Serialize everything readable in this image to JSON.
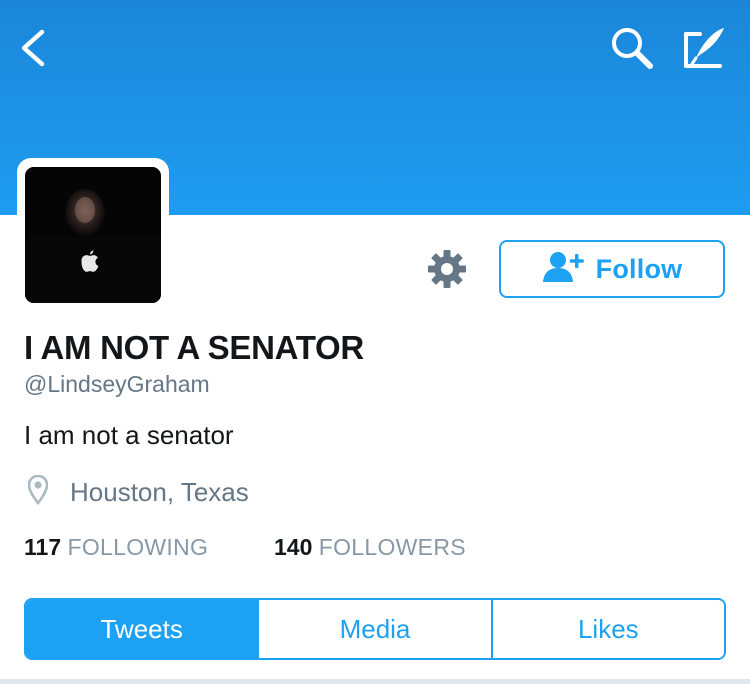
{
  "theme": {
    "accent": "#1da1f2",
    "header_blue": "#1d93e6",
    "muted": "#657786",
    "text": "#14171a"
  },
  "header": {
    "back_icon": "chevron-left-icon",
    "search_icon": "search-icon",
    "compose_icon": "compose-tweet-icon"
  },
  "profile": {
    "avatar_icon": "apple-logo-icon",
    "display_name": "I AM NOT A SENATOR",
    "handle": "@LindseyGraham",
    "bio": "I am not a senator",
    "location": "Houston, Texas",
    "location_icon": "map-pin-icon"
  },
  "actions": {
    "settings_icon": "gear-icon",
    "follow_icon": "add-user-icon",
    "follow_label": "Follow"
  },
  "stats": {
    "following_count": "117",
    "following_label": "FOLLOWING",
    "followers_count": "140",
    "followers_label": "FOLLOWERS"
  },
  "tabs": [
    {
      "label": "Tweets",
      "active": true
    },
    {
      "label": "Media",
      "active": false
    },
    {
      "label": "Likes",
      "active": false
    }
  ]
}
